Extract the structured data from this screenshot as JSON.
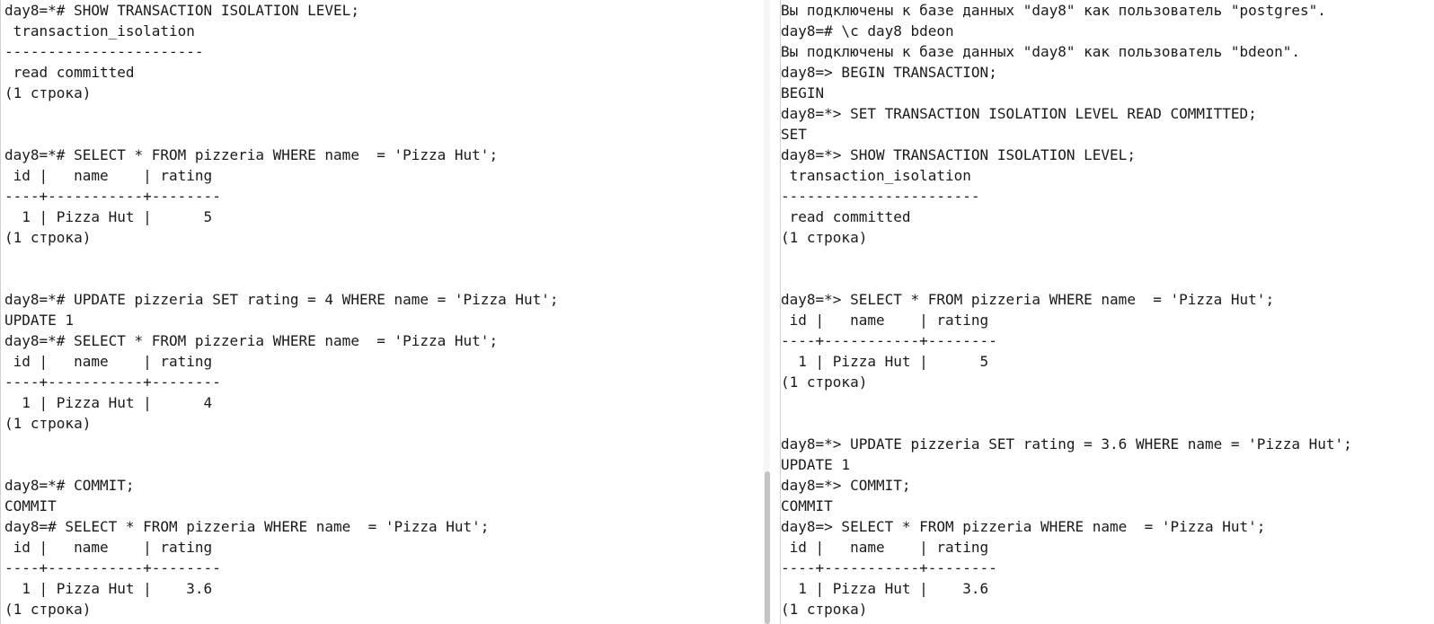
{
  "left_terminal": {
    "lines": [
      "day8=*# SHOW TRANSACTION ISOLATION LEVEL;",
      " transaction_isolation",
      "-----------------------",
      " read committed",
      "(1 строка)",
      "",
      "",
      "day8=*# SELECT * FROM pizzeria WHERE name  = 'Pizza Hut';",
      " id |   name    | rating",
      "----+-----------+--------",
      "  1 | Pizza Hut |      5",
      "(1 строка)",
      "",
      "",
      "day8=*# UPDATE pizzeria SET rating = 4 WHERE name = 'Pizza Hut';",
      "UPDATE 1",
      "day8=*# SELECT * FROM pizzeria WHERE name  = 'Pizza Hut';",
      " id |   name    | rating",
      "----+-----------+--------",
      "  1 | Pizza Hut |      4",
      "(1 строка)",
      "",
      "",
      "day8=*# COMMIT;",
      "COMMIT",
      "day8=# SELECT * FROM pizzeria WHERE name  = 'Pizza Hut';",
      " id |   name    | rating",
      "----+-----------+--------",
      "  1 | Pizza Hut |    3.6",
      "(1 строка)"
    ]
  },
  "right_terminal": {
    "lines": [
      "Вы подключены к базе данных \"day8\" как пользователь \"postgres\".",
      "day8=# \\c day8 bdeon",
      "Вы подключены к базе данных \"day8\" как пользователь \"bdeon\".",
      "day8=> BEGIN TRANSACTION;",
      "BEGIN",
      "day8=*> SET TRANSACTION ISOLATION LEVEL READ COMMITTED;",
      "SET",
      "day8=*> SHOW TRANSACTION ISOLATION LEVEL;",
      " transaction_isolation",
      "-----------------------",
      " read committed",
      "(1 строка)",
      "",
      "",
      "day8=*> SELECT * FROM pizzeria WHERE name  = 'Pizza Hut';",
      " id |   name    | rating",
      "----+-----------+--------",
      "  1 | Pizza Hut |      5",
      "(1 строка)",
      "",
      "",
      "day8=*> UPDATE pizzeria SET rating = 3.6 WHERE name = 'Pizza Hut';",
      "UPDATE 1",
      "day8=*> COMMIT;",
      "COMMIT",
      "day8=> SELECT * FROM pizzeria WHERE name  = 'Pizza Hut';",
      " id |   name    | rating",
      "----+-----------+--------",
      "  1 | Pizza Hut |    3.6",
      "(1 строка)"
    ]
  },
  "colors": {
    "background": "#ffffff",
    "text": "#1a1a1a",
    "scrollbar_thumb": "#c4c4c4"
  }
}
